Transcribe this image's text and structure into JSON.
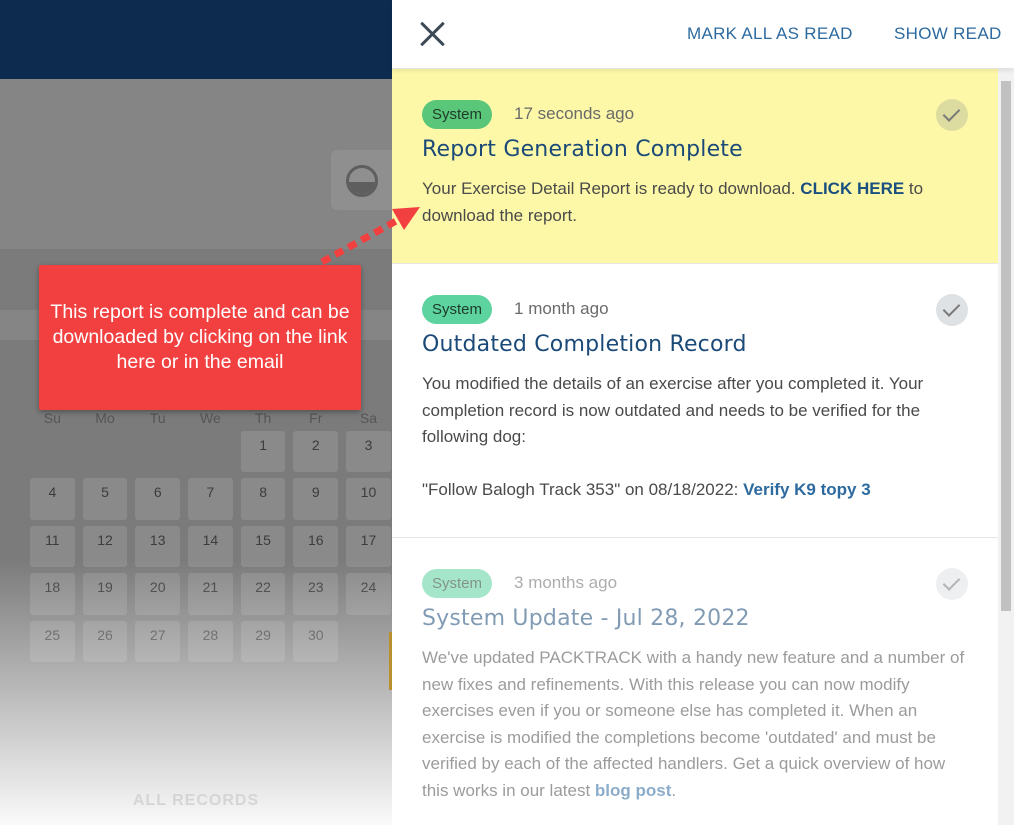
{
  "background": {
    "weekdays": [
      "Su",
      "Mo",
      "Tu",
      "We",
      "Th",
      "Fr",
      "Sa"
    ],
    "weeks": [
      [
        "",
        "",
        "",
        "",
        "1",
        "2",
        "3"
      ],
      [
        "4",
        "5",
        "6",
        "7",
        "8",
        "9",
        "10"
      ],
      [
        "11",
        "12",
        "13",
        "14",
        "15",
        "16",
        "17"
      ],
      [
        "18",
        "19",
        "20",
        "21",
        "22",
        "23",
        "24"
      ],
      [
        "25",
        "26",
        "27",
        "28",
        "29",
        "30",
        ""
      ]
    ],
    "footer_label": "ALL RECORDS"
  },
  "header": {
    "mark_all_label": "MARK ALL AS READ",
    "show_read_label": "SHOW READ"
  },
  "notifications": [
    {
      "badge": "System",
      "time": "17 seconds ago",
      "title": "Report Generation Complete",
      "body_before": "Your Exercise Detail Report is ready to download. ",
      "link": "CLICK HERE",
      "body_after": " to download the report."
    },
    {
      "badge": "System",
      "time": "1 month ago",
      "title": "Outdated Completion Record",
      "body": "You modified the details of an exercise after you completed it. Your completion record is now outdated and needs to be verified for the following dog:",
      "detail_before": "\"Follow Balogh Track 353\" on 08/18/2022: ",
      "detail_link": "Verify K9 topy 3"
    },
    {
      "badge": "System",
      "time": "3 months ago",
      "title": "System Update - Jul 28, 2022",
      "body_before": "We've updated PACKTRACK with a handy new feature and a number of new fixes and refinements. With this release you can now modify exercises even if you or someone else has completed it. When an exercise is modified the completions become 'outdated' and must be verified by each of the affected handlers. Get a quick overview of how this works in our latest ",
      "link": "blog post",
      "body_after": "."
    }
  ],
  "callout": {
    "text": "This report is complete and can be downloaded by clicking on the link here or in the email"
  },
  "colors": {
    "topbar": "#0c2b4f",
    "highlight": "#fdf8a7",
    "callout": "#f24040",
    "link": "#2d6a9f",
    "badge": "#5ac679"
  }
}
